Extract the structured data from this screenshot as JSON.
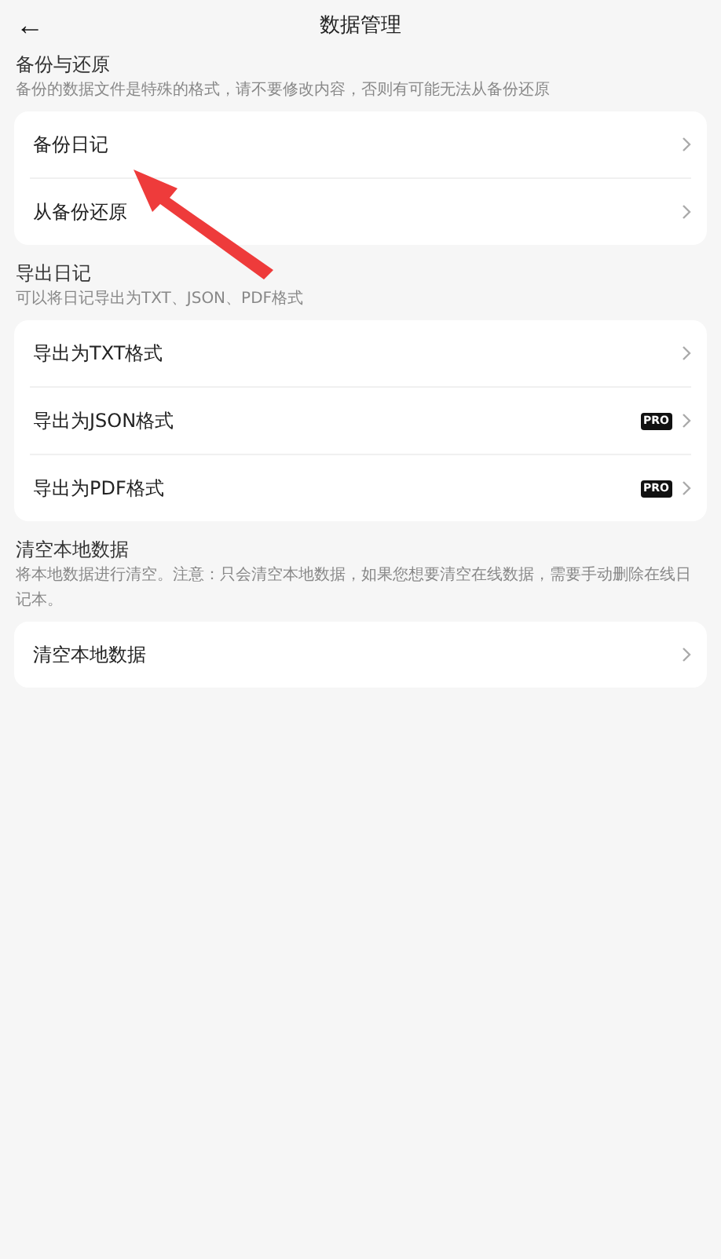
{
  "header": {
    "back": "←",
    "title": "数据管理"
  },
  "sections": [
    {
      "title": "备份与还原",
      "description": "备份的数据文件是特殊的格式，请不要修改内容，否则有可能无法从备份还原",
      "items": [
        {
          "label": "备份日记"
        },
        {
          "label": "从备份还原"
        }
      ]
    },
    {
      "title": "导出日记",
      "description": "可以将日记导出为TXT、JSON、PDF格式",
      "items": [
        {
          "label": "导出为TXT格式"
        },
        {
          "label": "导出为JSON格式",
          "badge": "PRO"
        },
        {
          "label": "导出为PDF格式",
          "badge": "PRO"
        }
      ]
    },
    {
      "title": "清空本地数据",
      "description": "将本地数据进行清空。注意：只会清空本地数据，如果您想要清空在线数据，需要手动删除在线日记本。",
      "items": [
        {
          "label": "清空本地数据"
        }
      ]
    }
  ]
}
